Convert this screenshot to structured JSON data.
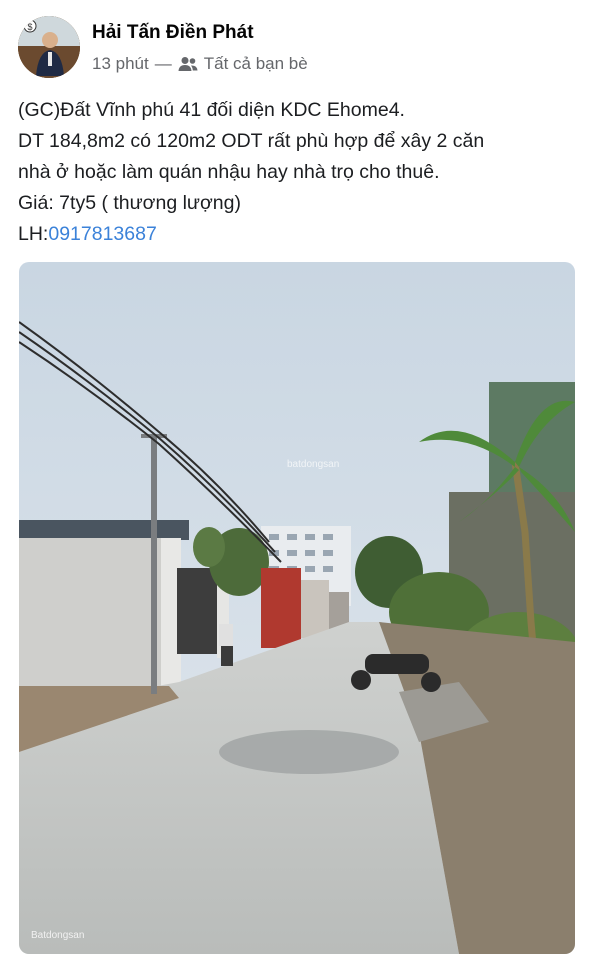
{
  "post": {
    "author_name": "Hải Tấn Điền Phát",
    "time": "13 phút",
    "separator": "—",
    "audience_icon": "friends-icon",
    "audience": "Tất cả bạn bè",
    "lines": [
      "(GC)Đất Vĩnh phú 41 đối diện KDC Ehome4.",
      "DT 184,8m2 có 120m2 ODT rất phù hợp để xây 2 căn",
      "nhà ở hoặc làm quán nhậu hay nhà trọ cho thuê.",
      "Giá: 7ty5 ( thương lượng)"
    ],
    "contact_prefix": "LH:",
    "contact_phone": "0917813687",
    "link_color": "#3b82d9"
  },
  "photo": {
    "watermark_center": "batdongsan",
    "watermark_corner": "Batdongsan"
  }
}
